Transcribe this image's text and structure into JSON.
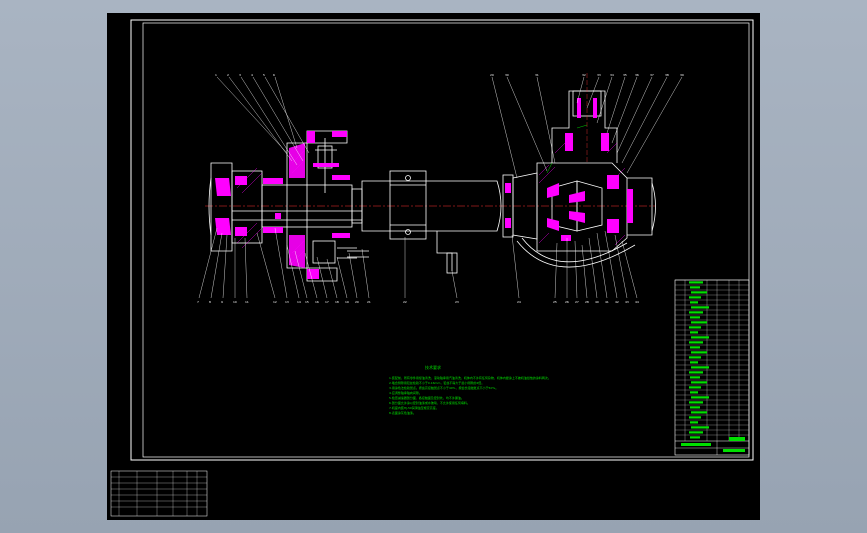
{
  "drawing": {
    "title_block": {
      "technical_requirements_heading": "技术要求",
      "technical_requirements_lines": [
        "1.装配前，所有零件用煤油清洗，滚动轴承用汽油清洗，机体内不许有任何杂物，机体内壁涂上不被机油侵蚀的涂料两次。",
        "2.啮合侧隙用铅丝检验不小于0.16mm，铅丝不得大于最小侧隙的4倍。",
        "3.用涂色法检验斑点。按齿高接触斑点不小于40%，按齿长接触斑点不小于50%。",
        "4.应调整轴承轴向间隙。",
        "5.检查减速器剖分面、各接触面及密封处，均不许漏油。",
        "6.剖分面允许涂以密封油漆或水玻璃，不允许使用任何填料。",
        "7.机座内装HJ-50润滑油至规定高度。",
        "8.表面涂灰色油漆。"
      ]
    },
    "colors": {
      "background": "#000000",
      "outline": "#ffffff",
      "section": "#ff00ff",
      "annotation": "#00ff00",
      "centerline": "#ff3030",
      "hatch": "#ff00ff"
    }
  }
}
